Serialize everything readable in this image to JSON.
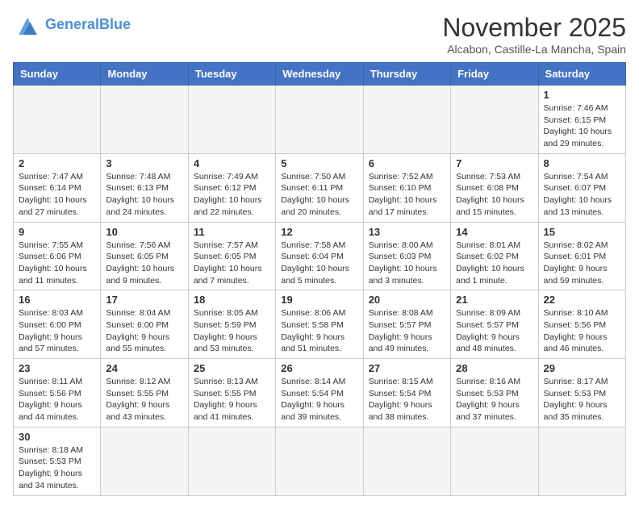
{
  "header": {
    "logo_general": "General",
    "logo_blue": "Blue",
    "month_title": "November 2025",
    "subtitle": "Alcabon, Castille-La Mancha, Spain"
  },
  "weekdays": [
    "Sunday",
    "Monday",
    "Tuesday",
    "Wednesday",
    "Thursday",
    "Friday",
    "Saturday"
  ],
  "weeks": [
    [
      {
        "day": "",
        "info": ""
      },
      {
        "day": "",
        "info": ""
      },
      {
        "day": "",
        "info": ""
      },
      {
        "day": "",
        "info": ""
      },
      {
        "day": "",
        "info": ""
      },
      {
        "day": "",
        "info": ""
      },
      {
        "day": "1",
        "info": "Sunrise: 7:46 AM\nSunset: 6:15 PM\nDaylight: 10 hours and 29 minutes."
      }
    ],
    [
      {
        "day": "2",
        "info": "Sunrise: 7:47 AM\nSunset: 6:14 PM\nDaylight: 10 hours and 27 minutes."
      },
      {
        "day": "3",
        "info": "Sunrise: 7:48 AM\nSunset: 6:13 PM\nDaylight: 10 hours and 24 minutes."
      },
      {
        "day": "4",
        "info": "Sunrise: 7:49 AM\nSunset: 6:12 PM\nDaylight: 10 hours and 22 minutes."
      },
      {
        "day": "5",
        "info": "Sunrise: 7:50 AM\nSunset: 6:11 PM\nDaylight: 10 hours and 20 minutes."
      },
      {
        "day": "6",
        "info": "Sunrise: 7:52 AM\nSunset: 6:10 PM\nDaylight: 10 hours and 17 minutes."
      },
      {
        "day": "7",
        "info": "Sunrise: 7:53 AM\nSunset: 6:08 PM\nDaylight: 10 hours and 15 minutes."
      },
      {
        "day": "8",
        "info": "Sunrise: 7:54 AM\nSunset: 6:07 PM\nDaylight: 10 hours and 13 minutes."
      }
    ],
    [
      {
        "day": "9",
        "info": "Sunrise: 7:55 AM\nSunset: 6:06 PM\nDaylight: 10 hours and 11 minutes."
      },
      {
        "day": "10",
        "info": "Sunrise: 7:56 AM\nSunset: 6:05 PM\nDaylight: 10 hours and 9 minutes."
      },
      {
        "day": "11",
        "info": "Sunrise: 7:57 AM\nSunset: 6:05 PM\nDaylight: 10 hours and 7 minutes."
      },
      {
        "day": "12",
        "info": "Sunrise: 7:58 AM\nSunset: 6:04 PM\nDaylight: 10 hours and 5 minutes."
      },
      {
        "day": "13",
        "info": "Sunrise: 8:00 AM\nSunset: 6:03 PM\nDaylight: 10 hours and 3 minutes."
      },
      {
        "day": "14",
        "info": "Sunrise: 8:01 AM\nSunset: 6:02 PM\nDaylight: 10 hours and 1 minute."
      },
      {
        "day": "15",
        "info": "Sunrise: 8:02 AM\nSunset: 6:01 PM\nDaylight: 9 hours and 59 minutes."
      }
    ],
    [
      {
        "day": "16",
        "info": "Sunrise: 8:03 AM\nSunset: 6:00 PM\nDaylight: 9 hours and 57 minutes."
      },
      {
        "day": "17",
        "info": "Sunrise: 8:04 AM\nSunset: 6:00 PM\nDaylight: 9 hours and 55 minutes."
      },
      {
        "day": "18",
        "info": "Sunrise: 8:05 AM\nSunset: 5:59 PM\nDaylight: 9 hours and 53 minutes."
      },
      {
        "day": "19",
        "info": "Sunrise: 8:06 AM\nSunset: 5:58 PM\nDaylight: 9 hours and 51 minutes."
      },
      {
        "day": "20",
        "info": "Sunrise: 8:08 AM\nSunset: 5:57 PM\nDaylight: 9 hours and 49 minutes."
      },
      {
        "day": "21",
        "info": "Sunrise: 8:09 AM\nSunset: 5:57 PM\nDaylight: 9 hours and 48 minutes."
      },
      {
        "day": "22",
        "info": "Sunrise: 8:10 AM\nSunset: 5:56 PM\nDaylight: 9 hours and 46 minutes."
      }
    ],
    [
      {
        "day": "23",
        "info": "Sunrise: 8:11 AM\nSunset: 5:56 PM\nDaylight: 9 hours and 44 minutes."
      },
      {
        "day": "24",
        "info": "Sunrise: 8:12 AM\nSunset: 5:55 PM\nDaylight: 9 hours and 43 minutes."
      },
      {
        "day": "25",
        "info": "Sunrise: 8:13 AM\nSunset: 5:55 PM\nDaylight: 9 hours and 41 minutes."
      },
      {
        "day": "26",
        "info": "Sunrise: 8:14 AM\nSunset: 5:54 PM\nDaylight: 9 hours and 39 minutes."
      },
      {
        "day": "27",
        "info": "Sunrise: 8:15 AM\nSunset: 5:54 PM\nDaylight: 9 hours and 38 minutes."
      },
      {
        "day": "28",
        "info": "Sunrise: 8:16 AM\nSunset: 5:53 PM\nDaylight: 9 hours and 37 minutes."
      },
      {
        "day": "29",
        "info": "Sunrise: 8:17 AM\nSunset: 5:53 PM\nDaylight: 9 hours and 35 minutes."
      }
    ],
    [
      {
        "day": "30",
        "info": "Sunrise: 8:18 AM\nSunset: 5:53 PM\nDaylight: 9 hours and 34 minutes."
      },
      {
        "day": "",
        "info": ""
      },
      {
        "day": "",
        "info": ""
      },
      {
        "day": "",
        "info": ""
      },
      {
        "day": "",
        "info": ""
      },
      {
        "day": "",
        "info": ""
      },
      {
        "day": "",
        "info": ""
      }
    ]
  ]
}
